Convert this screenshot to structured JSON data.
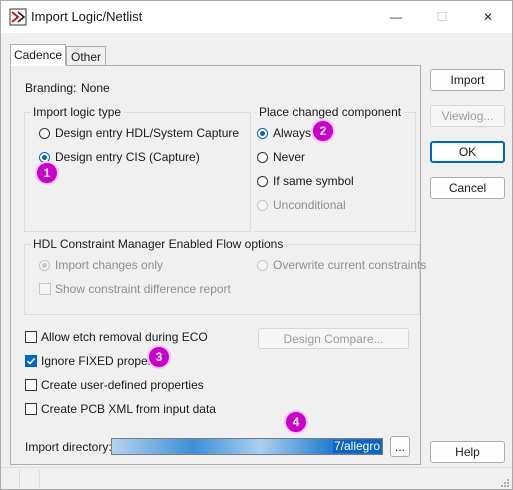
{
  "window": {
    "title": "Import Logic/Netlist",
    "controls": {
      "minimize": "—",
      "maximize": "☐",
      "close": "✕"
    }
  },
  "tabs": [
    {
      "label": "Cadence",
      "active": true
    },
    {
      "label": "Other",
      "active": false
    }
  ],
  "branding": {
    "label": "Branding:",
    "value": "None"
  },
  "import_logic_type": {
    "title": "Import logic type",
    "options": [
      {
        "label": "Design entry HDL/System Capture",
        "selected": false
      },
      {
        "label": "Design entry CIS (Capture)",
        "selected": true
      }
    ]
  },
  "place_changed_component": {
    "title": "Place changed component",
    "options": [
      {
        "label": "Always",
        "selected": true,
        "disabled": false
      },
      {
        "label": "Never",
        "selected": false,
        "disabled": false
      },
      {
        "label": "If same symbol",
        "selected": false,
        "disabled": false
      },
      {
        "label": "Unconditional",
        "selected": false,
        "disabled": true
      }
    ]
  },
  "hdl_flow": {
    "title": "HDL Constraint Manager Enabled Flow options",
    "import_changes_only": "Import changes only",
    "overwrite_constraints": "Overwrite current constraints",
    "show_difference_report": "Show constraint difference report"
  },
  "options": [
    {
      "label": "Allow etch removal during ECO",
      "checked": false
    },
    {
      "label": "Ignore FIXED property",
      "checked": true
    },
    {
      "label": "Create user-defined properties",
      "checked": false
    },
    {
      "label": "Create PCB XML from input data",
      "checked": false
    }
  ],
  "design_compare_button": "Design Compare...",
  "import_directory": {
    "label": "Import directory:",
    "value": "7/allegro",
    "browse_label": "..."
  },
  "side_buttons": {
    "import": "Import",
    "viewlog": "Viewlog...",
    "ok": "OK",
    "cancel": "Cancel",
    "help": "Help"
  },
  "annotations": [
    "1",
    "2",
    "3",
    "4"
  ],
  "colors": {
    "accent": "#0067c0",
    "badge": "#c900c9"
  }
}
